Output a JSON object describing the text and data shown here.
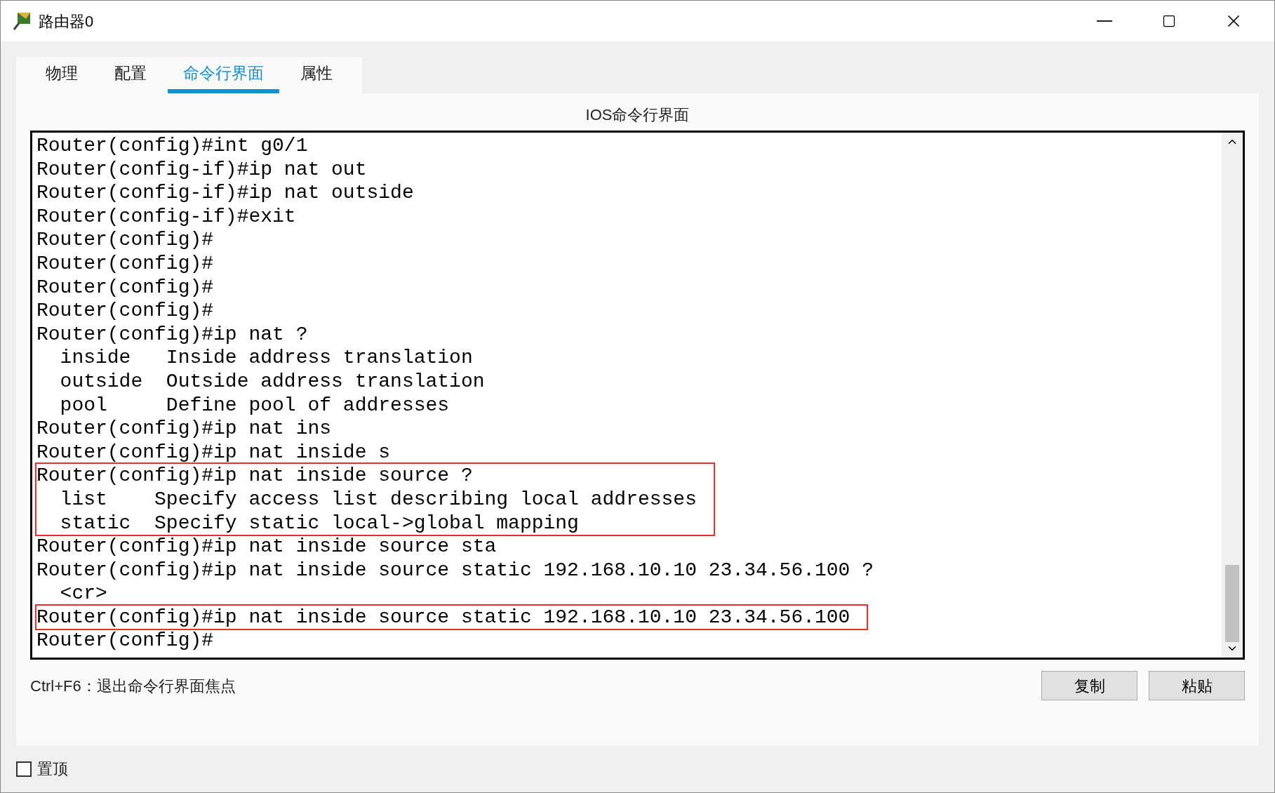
{
  "window": {
    "title": "路由器0"
  },
  "tabs": [
    {
      "label": "物理",
      "selected": false
    },
    {
      "label": "配置",
      "selected": false
    },
    {
      "label": "命令行界面",
      "selected": true
    },
    {
      "label": "属性",
      "selected": false
    }
  ],
  "panel_title": "IOS命令行界面",
  "terminal": [
    {
      "highlighted": false,
      "lines": [
        "Router(config)#int g0/1",
        "Router(config-if)#ip nat out",
        "Router(config-if)#ip nat outside",
        "Router(config-if)#exit",
        "Router(config)#",
        "Router(config)#",
        "Router(config)#",
        "Router(config)#",
        "Router(config)#ip nat ?",
        "  inside   Inside address translation",
        "  outside  Outside address translation",
        "  pool     Define pool of addresses",
        "Router(config)#ip nat ins",
        "Router(config)#ip nat inside s"
      ]
    },
    {
      "highlighted": true,
      "lines": [
        "Router(config)#ip nat inside source ?",
        "  list    Specify access list describing local addresses",
        "  static  Specify static local->global mapping"
      ]
    },
    {
      "highlighted": false,
      "lines": [
        "Router(config)#ip nat inside source sta",
        "Router(config)#ip nat inside source static 192.168.10.10 23.34.56.100 ?",
        "  <cr>"
      ]
    },
    {
      "highlighted": true,
      "lines": [
        "Router(config)#ip nat inside source static 192.168.10.10 23.34.56.100"
      ]
    },
    {
      "highlighted": false,
      "lines": [
        "Router(config)#"
      ]
    }
  ],
  "hint": "Ctrl+F6：退出命令行界面焦点",
  "buttons": [
    "复制",
    "粘贴"
  ],
  "pin": {
    "label": "置顶",
    "checked": false
  }
}
